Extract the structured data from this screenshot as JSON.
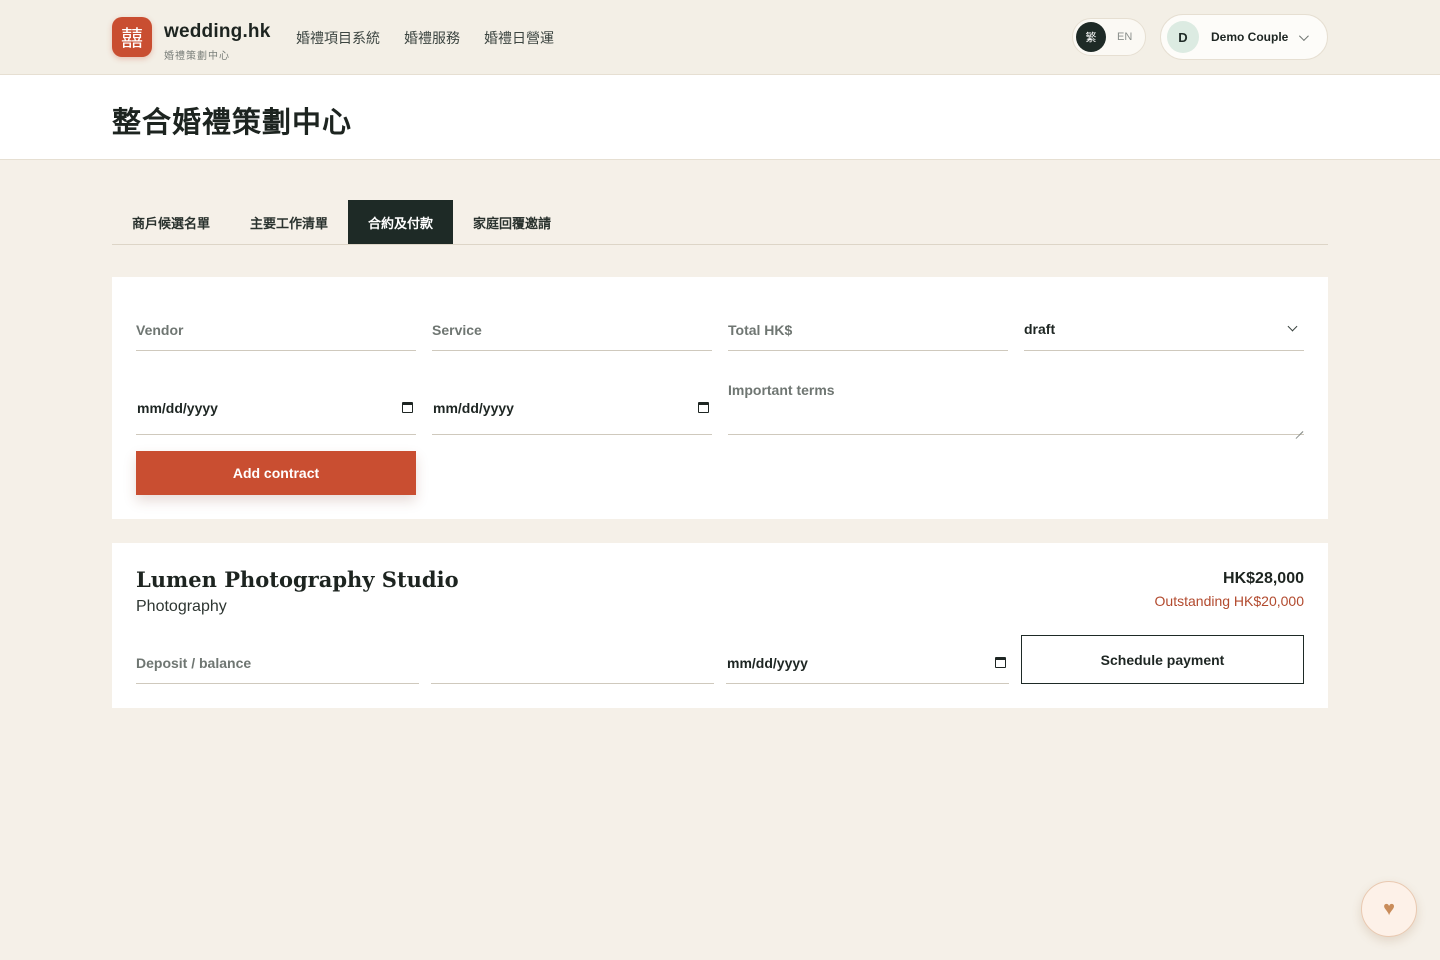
{
  "header": {
    "logo_glyph": "囍",
    "brand_name": "wedding.hk",
    "brand_sub": "婚禮策劃中心",
    "nav": [
      "婚禮項目系統",
      "婚禮服務",
      "婚禮日營運"
    ],
    "lang_active": "繁",
    "lang_other": "EN",
    "user_initial": "D",
    "user_name": "Demo Couple"
  },
  "page": {
    "title": "整合婚禮策劃中心"
  },
  "tabs": [
    {
      "label": "商戶候選名單",
      "active": false
    },
    {
      "label": "主要工作清單",
      "active": false
    },
    {
      "label": "合約及付款",
      "active": true
    },
    {
      "label": "家庭回覆邀請",
      "active": false
    }
  ],
  "form": {
    "vendor_placeholder": "Vendor",
    "service_placeholder": "Service",
    "total_placeholder": "Total HK$",
    "status_value": "draft",
    "date1_value": "mm/dd/yyyy",
    "date2_value": "mm/dd/yyyy",
    "terms_placeholder": "Important terms",
    "submit_label": "Add contract"
  },
  "contract": {
    "vendor": "Lumen Photography Studio",
    "service": "Photography",
    "total": "HK$28,000",
    "outstanding": "Outstanding HK$20,000",
    "payment_label_placeholder": "Deposit / balance",
    "amount_value": "",
    "due_date_value": "mm/dd/yyyy",
    "schedule_label": "Schedule payment"
  },
  "fab": {
    "icon": "heart-icon"
  },
  "colors": {
    "accent": "#c94e31",
    "dark": "#1e2a26",
    "background": "#f5f0e8",
    "outstanding": "#b24a2e"
  }
}
